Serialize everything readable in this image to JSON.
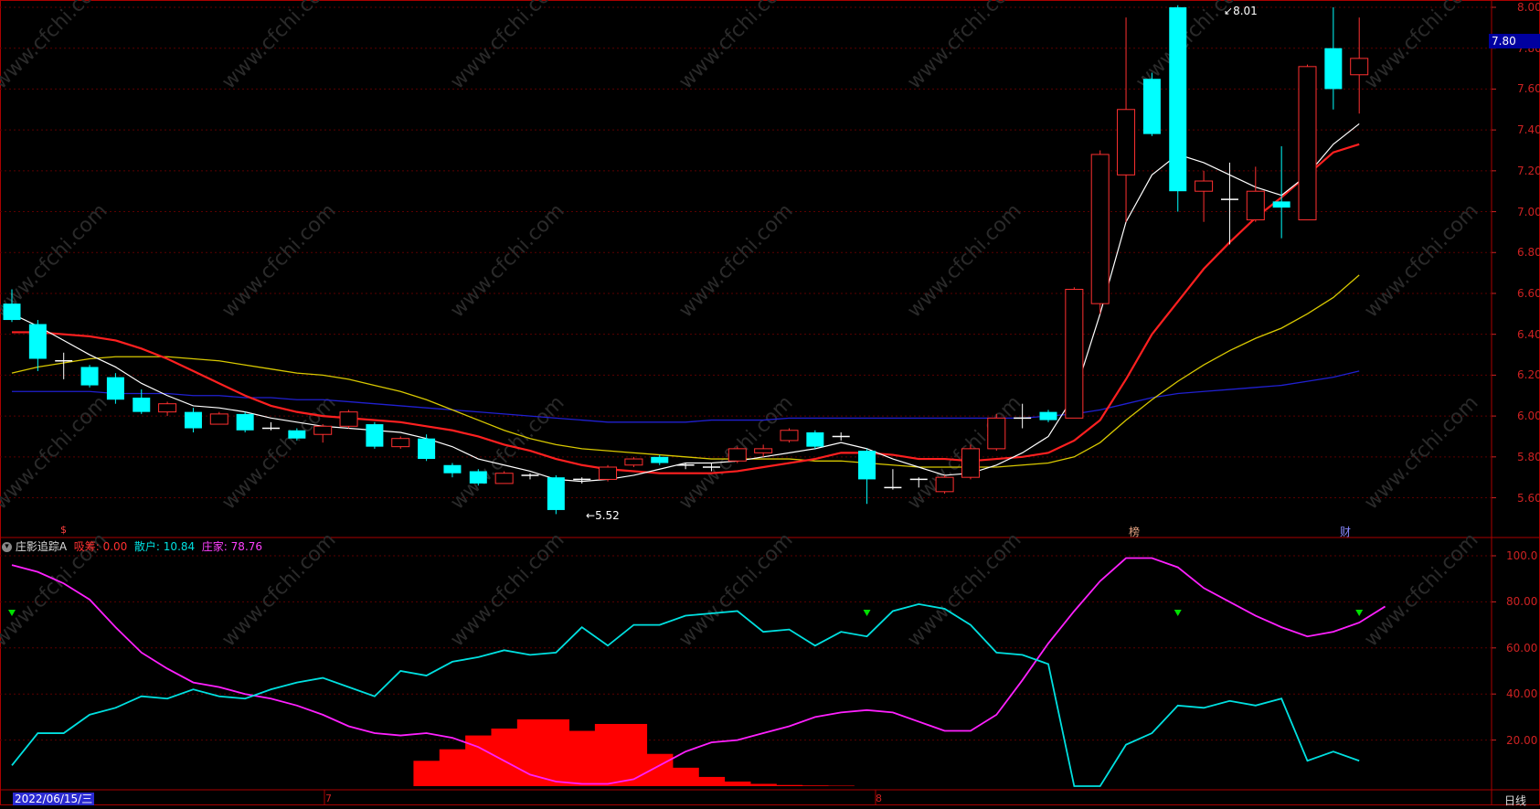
{
  "colors": {
    "bg": "#000000",
    "grid": "#5a0000",
    "border": "#aa0000",
    "axis_text": "#cc2222",
    "up": "#ff3030",
    "down": "#00ffff",
    "ma5": "#ffffff",
    "ma10": "#ff2020",
    "ma20": "#d8c800",
    "ma60": "#2020d0",
    "retail": "#00e0e0",
    "banker": "#ff20ff",
    "chip_bar": "#ff0000",
    "signal": "#00e000"
  },
  "price_axis": {
    "ticks": [
      "8.00",
      "7.80",
      "7.60",
      "7.40",
      "7.20",
      "7.00",
      "6.80",
      "6.60",
      "6.40",
      "6.20",
      "6.00",
      "5.80",
      "5.60"
    ],
    "current": "7.80"
  },
  "indicator_axis": {
    "ticks": [
      "100.0",
      "80.00",
      "60.00",
      "40.00",
      "20.00"
    ]
  },
  "annotations": {
    "high_label": "8.01",
    "low_label": "5.52",
    "marker_s": "$",
    "marker_bang": "榜",
    "marker_cai": "财"
  },
  "indicator_header": {
    "name": "庄影追踪A",
    "f1_label": "吸筹:",
    "f1_value": "0.00",
    "f2_label": "散户:",
    "f2_value": "10.84",
    "f3_label": "庄家:",
    "f3_value": "78.76"
  },
  "footer": {
    "date": "2022/06/15/三",
    "month7": "7",
    "month8": "8",
    "period": "日线"
  },
  "watermark": "www.cfchi.com",
  "chart_data": [
    {
      "type": "candlestick",
      "title": "",
      "ylim": [
        5.5,
        8.02
      ],
      "candles": [
        [
          6.55,
          6.47,
          6.62,
          6.46
        ],
        [
          6.45,
          6.28,
          6.47,
          6.22
        ],
        [
          6.27,
          6.27,
          6.31,
          6.18
        ],
        [
          6.24,
          6.15,
          6.25,
          6.14
        ],
        [
          6.19,
          6.08,
          6.21,
          6.06
        ],
        [
          6.09,
          6.02,
          6.13,
          6.01
        ],
        [
          6.02,
          6.06,
          6.07,
          6.0
        ],
        [
          6.02,
          5.94,
          6.04,
          5.92
        ],
        [
          5.96,
          6.01,
          6.02,
          5.96
        ],
        [
          6.01,
          5.93,
          6.02,
          5.92
        ],
        [
          5.94,
          5.94,
          5.97,
          5.93
        ],
        [
          5.93,
          5.89,
          5.94,
          5.88
        ],
        [
          5.91,
          5.95,
          5.96,
          5.87
        ],
        [
          5.95,
          6.02,
          6.03,
          5.94
        ],
        [
          5.96,
          5.85,
          5.97,
          5.84
        ],
        [
          5.85,
          5.89,
          5.9,
          5.84
        ],
        [
          5.89,
          5.79,
          5.91,
          5.78
        ],
        [
          5.76,
          5.72,
          5.77,
          5.7
        ],
        [
          5.73,
          5.67,
          5.74,
          5.66
        ],
        [
          5.67,
          5.72,
          5.73,
          5.67
        ],
        [
          5.71,
          5.71,
          5.72,
          5.69
        ],
        [
          5.7,
          5.54,
          5.71,
          5.52
        ],
        [
          5.69,
          5.69,
          5.7,
          5.67
        ],
        [
          5.69,
          5.75,
          5.76,
          5.68
        ],
        [
          5.76,
          5.79,
          5.8,
          5.75
        ],
        [
          5.8,
          5.77,
          5.81,
          5.76
        ],
        [
          5.76,
          5.76,
          5.77,
          5.74
        ],
        [
          5.75,
          5.75,
          5.77,
          5.73
        ],
        [
          5.78,
          5.84,
          5.85,
          5.77
        ],
        [
          5.82,
          5.84,
          5.86,
          5.8
        ],
        [
          5.88,
          5.93,
          5.94,
          5.87
        ],
        [
          5.92,
          5.85,
          5.93,
          5.84
        ],
        [
          5.9,
          5.9,
          5.92,
          5.88
        ],
        [
          5.83,
          5.69,
          5.84,
          5.57
        ],
        [
          5.65,
          5.65,
          5.74,
          5.64
        ],
        [
          5.69,
          5.69,
          5.7,
          5.65
        ],
        [
          5.63,
          5.7,
          5.71,
          5.62
        ],
        [
          5.7,
          5.84,
          5.86,
          5.69
        ],
        [
          5.84,
          5.99,
          6.01,
          5.83
        ],
        [
          5.99,
          5.99,
          6.06,
          5.94
        ],
        [
          6.02,
          5.98,
          6.03,
          5.97
        ],
        [
          5.99,
          6.62,
          6.63,
          5.99
        ],
        [
          6.55,
          7.28,
          7.3,
          6.5
        ],
        [
          7.18,
          7.5,
          7.95,
          6.95
        ],
        [
          7.65,
          7.38,
          7.68,
          7.37
        ],
        [
          8.0,
          7.1,
          8.01,
          7.0
        ],
        [
          7.1,
          7.15,
          7.2,
          6.95
        ],
        [
          7.06,
          7.06,
          7.24,
          6.84
        ],
        [
          6.96,
          7.1,
          7.22,
          6.95
        ],
        [
          7.05,
          7.02,
          7.32,
          6.87
        ],
        [
          6.96,
          7.71,
          7.72,
          6.96
        ],
        [
          7.8,
          7.6,
          8.0,
          7.5
        ],
        [
          7.67,
          7.75,
          7.95,
          7.48
        ]
      ],
      "ma5": [
        6.5,
        6.44,
        6.37,
        6.3,
        6.24,
        6.16,
        6.1,
        6.05,
        6.04,
        6.02,
        5.99,
        5.97,
        5.95,
        5.94,
        5.93,
        5.92,
        5.89,
        5.85,
        5.79,
        5.76,
        5.73,
        5.69,
        5.68,
        5.69,
        5.71,
        5.74,
        5.77,
        5.77,
        5.78,
        5.8,
        5.82,
        5.84,
        5.87,
        5.84,
        5.79,
        5.75,
        5.71,
        5.72,
        5.76,
        5.82,
        5.9,
        6.1,
        6.5,
        6.95,
        7.18,
        7.28,
        7.24,
        7.18,
        7.12,
        7.08,
        7.18,
        7.33,
        7.43
      ],
      "ma10": [
        6.41,
        6.41,
        6.4,
        6.39,
        6.37,
        6.33,
        6.28,
        6.22,
        6.16,
        6.1,
        6.05,
        6.02,
        6.0,
        5.99,
        5.98,
        5.97,
        5.95,
        5.93,
        5.9,
        5.86,
        5.83,
        5.79,
        5.76,
        5.74,
        5.73,
        5.72,
        5.72,
        5.72,
        5.73,
        5.75,
        5.77,
        5.79,
        5.82,
        5.82,
        5.81,
        5.79,
        5.79,
        5.78,
        5.79,
        5.8,
        5.82,
        5.88,
        5.98,
        6.18,
        6.4,
        6.56,
        6.72,
        6.85,
        6.97,
        7.07,
        7.18,
        7.29,
        7.33
      ],
      "ma20": [
        6.21,
        6.24,
        6.26,
        6.28,
        6.29,
        6.29,
        6.29,
        6.28,
        6.27,
        6.25,
        6.23,
        6.21,
        6.2,
        6.18,
        6.15,
        6.12,
        6.08,
        6.03,
        5.98,
        5.93,
        5.89,
        5.86,
        5.84,
        5.83,
        5.82,
        5.81,
        5.8,
        5.79,
        5.79,
        5.79,
        5.79,
        5.78,
        5.78,
        5.77,
        5.76,
        5.75,
        5.75,
        5.75,
        5.75,
        5.76,
        5.77,
        5.8,
        5.87,
        5.98,
        6.08,
        6.17,
        6.25,
        6.32,
        6.38,
        6.43,
        6.5,
        6.58,
        6.69
      ],
      "ma60": [
        6.12,
        6.12,
        6.12,
        6.12,
        6.11,
        6.11,
        6.11,
        6.1,
        6.1,
        6.09,
        6.09,
        6.08,
        6.08,
        6.07,
        6.06,
        6.05,
        6.04,
        6.03,
        6.02,
        6.01,
        6.0,
        5.99,
        5.98,
        5.97,
        5.97,
        5.97,
        5.97,
        5.98,
        5.98,
        5.98,
        5.99,
        5.99,
        5.99,
        5.99,
        5.99,
        5.99,
        5.99,
        5.99,
        5.99,
        5.99,
        6.0,
        6.01,
        6.03,
        6.06,
        6.09,
        6.11,
        6.12,
        6.13,
        6.14,
        6.15,
        6.17,
        6.19,
        6.22
      ]
    },
    {
      "type": "line",
      "title": "庄影追踪A",
      "ylim": [
        0,
        100
      ],
      "series": [
        {
          "name": "散户",
          "values": [
            9,
            23,
            23,
            31,
            34,
            39,
            38,
            42,
            39,
            38,
            42,
            45,
            47,
            43,
            39,
            50,
            48,
            54,
            56,
            59,
            57,
            58,
            69,
            61,
            70,
            70,
            74,
            75,
            76,
            67,
            68,
            61,
            67,
            65,
            76,
            79,
            77,
            70,
            58,
            57,
            53,
            0,
            0,
            18,
            23,
            35,
            34,
            37,
            35,
            38,
            11,
            15,
            11
          ]
        },
        {
          "name": "庄家",
          "values": [
            96,
            93,
            88,
            81,
            69,
            58,
            51,
            45,
            43,
            40,
            38,
            35,
            31,
            26,
            23,
            22,
            23,
            21,
            17,
            11,
            5,
            2,
            1,
            1,
            3,
            9,
            15,
            19,
            20,
            23,
            26,
            30,
            32,
            33,
            32,
            28,
            24,
            24,
            31,
            46,
            62,
            76,
            89,
            99,
            99,
            95,
            86,
            80,
            74,
            69,
            65,
            67,
            71,
            78
          ]
        },
        {
          "name": "吸筹",
          "values": [
            0,
            0,
            0,
            0,
            0,
            0,
            0,
            0,
            0,
            0,
            0,
            0,
            0,
            0,
            0,
            0,
            11,
            16,
            22,
            25,
            29,
            29,
            24,
            27,
            27,
            14,
            8,
            4,
            2,
            1,
            0.5,
            0.3,
            0.2,
            0,
            0,
            0,
            0,
            0,
            0,
            0,
            0,
            0,
            0,
            0,
            0,
            0,
            0,
            0,
            0,
            0,
            0,
            0,
            0
          ]
        }
      ],
      "signals": [
        0,
        33,
        45,
        52
      ]
    }
  ]
}
